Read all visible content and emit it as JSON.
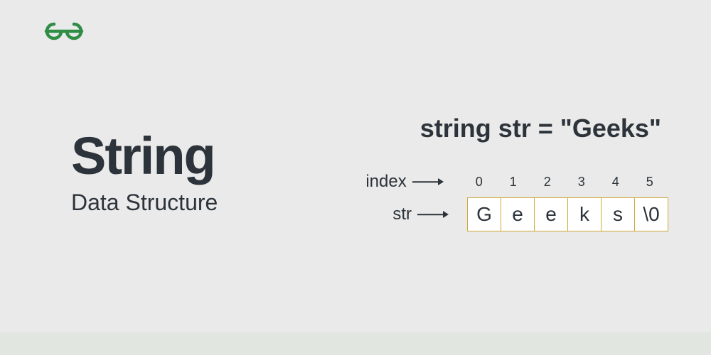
{
  "logo": {
    "color": "#2f8d46"
  },
  "title": "String",
  "subtitle": "Data Structure",
  "declaration": "string str = \"Geeks\"",
  "labels": {
    "index": "index",
    "str": "str"
  },
  "indices": [
    "0",
    "1",
    "2",
    "3",
    "4",
    "5"
  ],
  "cells": [
    "G",
    "e",
    "e",
    "k",
    "s",
    "\\0"
  ]
}
